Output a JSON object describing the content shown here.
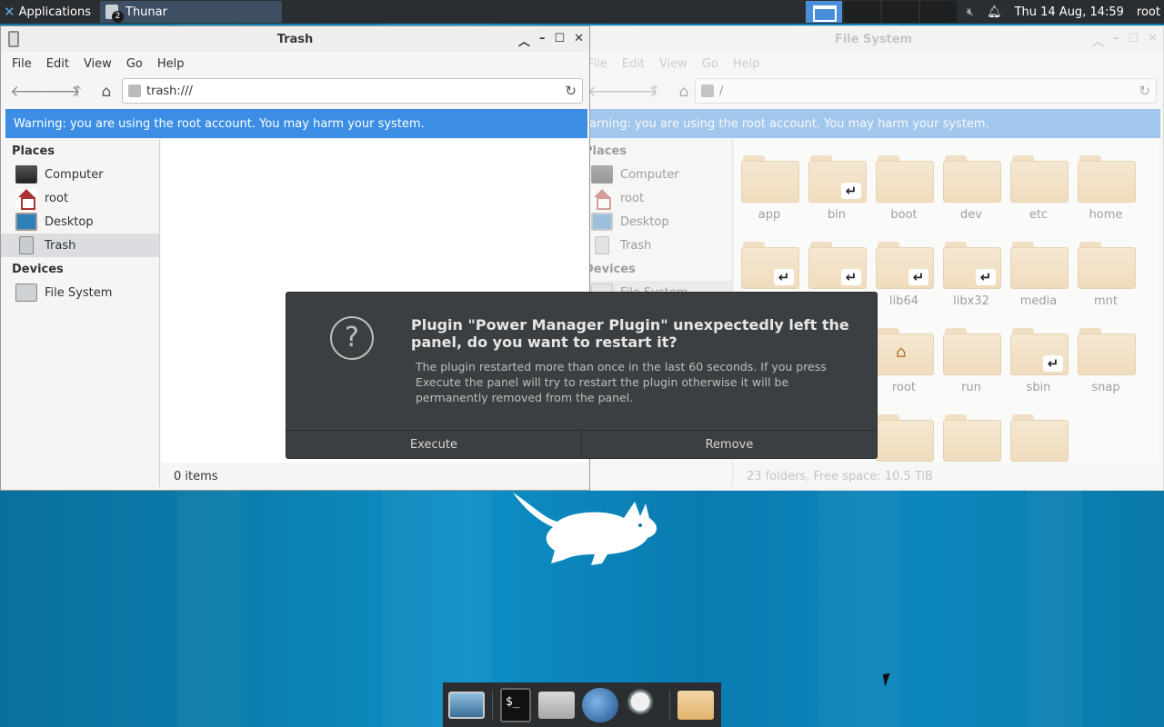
{
  "top_panel": {
    "applications_label": "Applications",
    "task_label": "Thunar",
    "task_badge": "2",
    "clock": "Thu 14 Aug, 14:59",
    "user": "root"
  },
  "trash_window": {
    "title": "Trash",
    "menu": [
      "File",
      "Edit",
      "View",
      "Go",
      "Help"
    ],
    "path": "trash:///",
    "warning": "Warning: you are using the root account. You may harm your system.",
    "places_header": "Places",
    "places": [
      "Computer",
      "root",
      "Desktop",
      "Trash"
    ],
    "devices_header": "Devices",
    "devices": [
      "File System"
    ],
    "status": "0 items"
  },
  "fs_window": {
    "title": "File System",
    "menu": [
      "File",
      "Edit",
      "View",
      "Go",
      "Help"
    ],
    "path": "/",
    "warning": "Warning: you are using the root account. You may harm your system.",
    "places_header": "Places",
    "places": [
      "Computer",
      "root",
      "Desktop",
      "Trash"
    ],
    "devices_header": "Devices",
    "devices": [
      "File System"
    ],
    "folders": [
      "app",
      "bin",
      "boot",
      "dev",
      "etc",
      "home",
      "lib64",
      "libx32",
      "media",
      "mnt",
      "root",
      "run",
      "sbin",
      "snap"
    ],
    "status": "23 folders, Free space: 10.5 TiB"
  },
  "dialog": {
    "title": "Plugin \"Power Manager Plugin\" unexpectedly left the panel, do you want to restart it?",
    "body": "The plugin restarted more than once in the last 60 seconds. If you press Execute the panel will try to restart the plugin otherwise it will be permanently removed from the panel.",
    "execute_label": "Execute",
    "remove_label": "Remove"
  },
  "icons": {
    "apps": "xfce-icon",
    "back": "arrow-left-icon",
    "forward": "arrow-right-icon",
    "up": "arrow-up-icon",
    "home": "home-icon",
    "reload": "reload-icon",
    "question": "question-icon",
    "mute": "volume-muted-icon",
    "bell": "bell-icon"
  }
}
